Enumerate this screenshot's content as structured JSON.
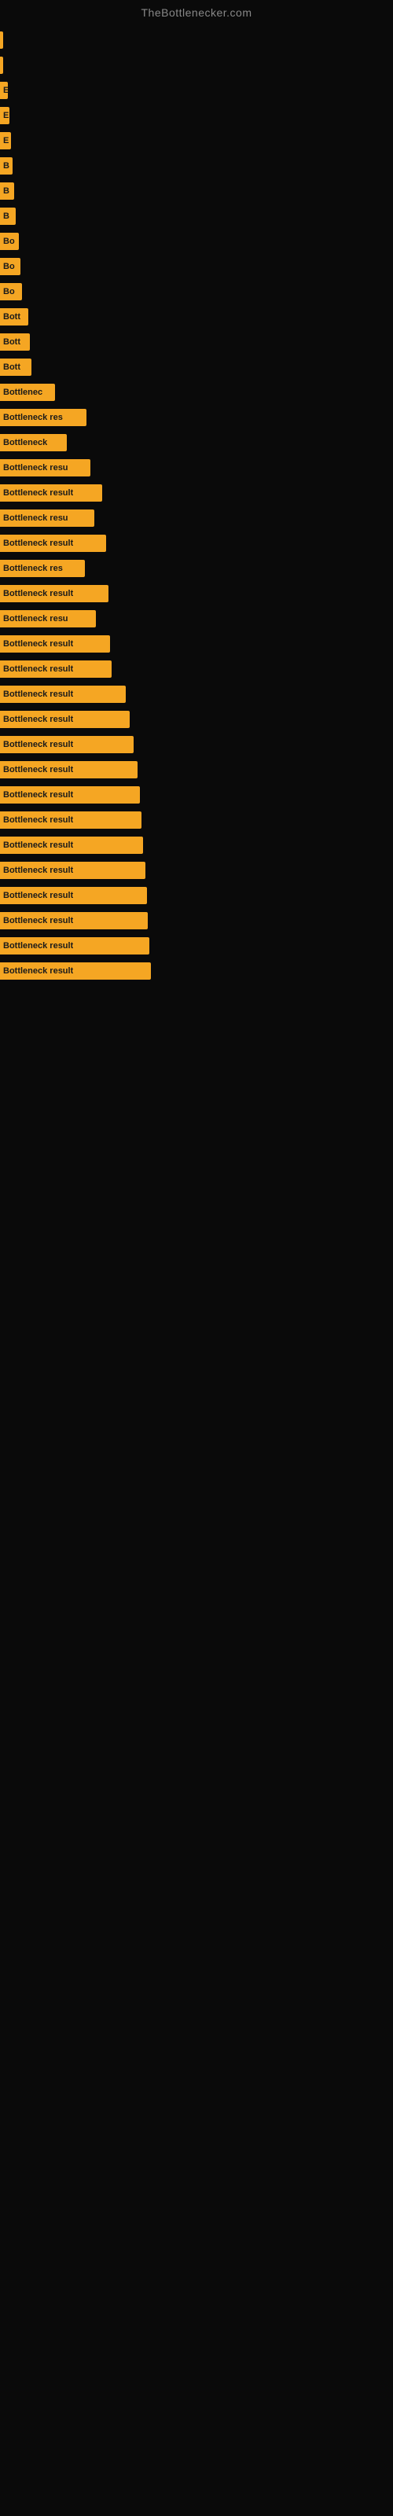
{
  "site_title": "TheBottlenecker.com",
  "bars": [
    {
      "label": "",
      "width": 4
    },
    {
      "label": "",
      "width": 4
    },
    {
      "label": "E",
      "width": 10
    },
    {
      "label": "E",
      "width": 12
    },
    {
      "label": "E",
      "width": 14
    },
    {
      "label": "B",
      "width": 16
    },
    {
      "label": "B",
      "width": 18
    },
    {
      "label": "B",
      "width": 20
    },
    {
      "label": "Bo",
      "width": 24
    },
    {
      "label": "Bo",
      "width": 26
    },
    {
      "label": "Bo",
      "width": 28
    },
    {
      "label": "Bott",
      "width": 36
    },
    {
      "label": "Bott",
      "width": 38
    },
    {
      "label": "Bott",
      "width": 40
    },
    {
      "label": "Bottlenec",
      "width": 70
    },
    {
      "label": "Bottleneck res",
      "width": 110
    },
    {
      "label": "Bottleneck",
      "width": 85
    },
    {
      "label": "Bottleneck resu",
      "width": 115
    },
    {
      "label": "Bottleneck result",
      "width": 130
    },
    {
      "label": "Bottleneck resu",
      "width": 120
    },
    {
      "label": "Bottleneck result",
      "width": 135
    },
    {
      "label": "Bottleneck res",
      "width": 108
    },
    {
      "label": "Bottleneck result",
      "width": 138
    },
    {
      "label": "Bottleneck resu",
      "width": 122
    },
    {
      "label": "Bottleneck result",
      "width": 140
    },
    {
      "label": "Bottleneck result",
      "width": 142
    },
    {
      "label": "Bottleneck result",
      "width": 160
    },
    {
      "label": "Bottleneck result",
      "width": 165
    },
    {
      "label": "Bottleneck result",
      "width": 170
    },
    {
      "label": "Bottleneck result",
      "width": 175
    },
    {
      "label": "Bottleneck result",
      "width": 178
    },
    {
      "label": "Bottleneck result",
      "width": 180
    },
    {
      "label": "Bottleneck result",
      "width": 182
    },
    {
      "label": "Bottleneck result",
      "width": 185
    },
    {
      "label": "Bottleneck result",
      "width": 187
    },
    {
      "label": "Bottleneck result",
      "width": 188
    },
    {
      "label": "Bottleneck result",
      "width": 190
    },
    {
      "label": "Bottleneck result",
      "width": 192
    }
  ]
}
